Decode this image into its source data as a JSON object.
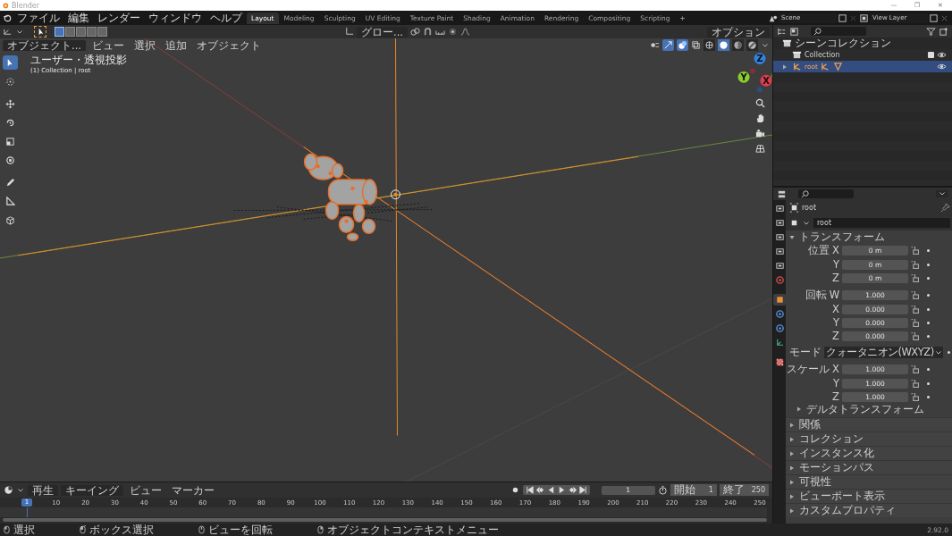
{
  "window": {
    "title": "Blender",
    "controls": [
      "—",
      "❐",
      "✕"
    ]
  },
  "menu": [
    "ファイル",
    "編集",
    "レンダー",
    "ウィンドウ",
    "ヘルプ"
  ],
  "workspace_tabs": [
    {
      "label": "Layout",
      "selected": true
    },
    {
      "label": "Modeling",
      "selected": false
    },
    {
      "label": "Sculpting",
      "selected": false
    },
    {
      "label": "UV Editing",
      "selected": false
    },
    {
      "label": "Texture Paint",
      "selected": false
    },
    {
      "label": "Shading",
      "selected": false
    },
    {
      "label": "Animation",
      "selected": false
    },
    {
      "label": "Rendering",
      "selected": false
    },
    {
      "label": "Compositing",
      "selected": false
    },
    {
      "label": "Scripting",
      "selected": false
    }
  ],
  "add_tab": "+",
  "scene": {
    "name": "Scene"
  },
  "view_layer": {
    "name": "View Layer"
  },
  "viewport": {
    "select_modes": [
      {
        "selected": true
      },
      {
        "selected": false
      },
      {
        "selected": false
      },
      {
        "selected": false
      },
      {
        "selected": false
      }
    ],
    "orientation": "グロー...",
    "mode": "オブジェクト...",
    "menus": [
      "ビュー",
      "選択",
      "追加",
      "オブジェクト"
    ],
    "options": "オプション",
    "shading": [
      {
        "kind": "wireframe",
        "selected": false
      },
      {
        "kind": "solid",
        "selected": true
      },
      {
        "kind": "material",
        "selected": false
      },
      {
        "kind": "rendered",
        "selected": false
      }
    ],
    "view_name": "ユーザー・透視投影",
    "context": "(1) Collection | root",
    "tools": [
      {
        "kind": "select",
        "selected": true
      },
      {
        "kind": "cursor",
        "selected": false
      },
      {
        "kind": "move",
        "selected": false
      },
      {
        "kind": "rotate",
        "selected": false
      },
      {
        "kind": "scale",
        "selected": false
      },
      {
        "kind": "transform",
        "selected": false
      },
      {
        "kind": "annotate",
        "selected": false
      },
      {
        "kind": "measure",
        "selected": false
      },
      {
        "kind": "add-cube",
        "selected": false
      }
    ],
    "gizmo": {
      "x": "X",
      "y": "Y",
      "z": "Z"
    }
  },
  "outliner": {
    "title": "シーンコレクション",
    "items": [
      {
        "kind": "collection",
        "name": "Collection",
        "selected": false,
        "checked": true
      },
      {
        "kind": "armature",
        "name": "root",
        "selected": true,
        "expanded": false
      }
    ]
  },
  "properties": {
    "tabs": [
      {
        "kind": "tool",
        "selected": false
      },
      {
        "kind": "render",
        "selected": false
      },
      {
        "kind": "output",
        "selected": false
      },
      {
        "kind": "view-layer",
        "selected": false
      },
      {
        "kind": "scene",
        "selected": false
      },
      {
        "kind": "world",
        "selected": false
      },
      {
        "kind": "object",
        "selected": true
      },
      {
        "kind": "physics",
        "selected": false
      },
      {
        "kind": "constraints",
        "selected": false
      },
      {
        "kind": "data",
        "selected": false
      },
      {
        "kind": "texture",
        "selected": false
      }
    ],
    "object_name": "root",
    "data_name": "root",
    "transform": {
      "title": "トランスフォーム",
      "expanded": true,
      "groups": [
        {
          "label": "位置",
          "rows": [
            {
              "axis": "X",
              "value": "0 m"
            },
            {
              "axis": "Y",
              "value": "0 m"
            },
            {
              "axis": "Z",
              "value": "0 m"
            }
          ]
        },
        {
          "label": "回転",
          "rows": [
            {
              "axis": "W",
              "value": "1.000"
            },
            {
              "axis": "X",
              "value": "0.000"
            },
            {
              "axis": "Y",
              "value": "0.000"
            },
            {
              "axis": "Z",
              "value": "0.000"
            }
          ]
        }
      ],
      "mode": {
        "label": "モード",
        "value": "クォータニオン(WXYZ)"
      },
      "scale": {
        "label": "スケール",
        "rows": [
          {
            "axis": "X",
            "value": "1.000"
          },
          {
            "axis": "Y",
            "value": "1.000"
          },
          {
            "axis": "Z",
            "value": "1.000"
          }
        ]
      },
      "delta": {
        "title": "デルタトランスフォーム",
        "expanded": false
      }
    },
    "sections": [
      {
        "title": "関係",
        "expanded": false
      },
      {
        "title": "コレクション",
        "expanded": false
      },
      {
        "title": "インスタンス化",
        "expanded": false
      },
      {
        "title": "モーションパス",
        "expanded": false
      },
      {
        "title": "可視性",
        "expanded": false
      },
      {
        "title": "ビューポート表示",
        "expanded": false
      },
      {
        "title": "カスタムプロパティ",
        "expanded": false
      }
    ]
  },
  "timeline": {
    "menus": [
      {
        "label": "再生",
        "dropdown": true
      },
      {
        "label": "キーイング",
        "dropdown": true
      },
      {
        "label": "ビュー",
        "dropdown": false
      },
      {
        "label": "マーカー",
        "dropdown": false
      }
    ],
    "current_frame": "1",
    "start_label": "開始",
    "start": "1",
    "end_label": "終了",
    "end": "250",
    "ruler": [
      "1",
      "10",
      "20",
      "30",
      "40",
      "50",
      "60",
      "70",
      "80",
      "90",
      "100",
      "110",
      "120",
      "130",
      "140",
      "150",
      "160",
      "170",
      "180",
      "190",
      "200",
      "210",
      "220",
      "230",
      "240",
      "250"
    ]
  },
  "status_bar": {
    "hints": [
      {
        "kind": "left-click",
        "label": "選択"
      },
      {
        "kind": "drag",
        "label": "ボックス選択"
      },
      {
        "kind": "middle-click",
        "label": "ビューを回転"
      },
      {
        "kind": "right-click",
        "label": "オブジェクトコンテキストメニュー"
      }
    ],
    "version": "2.92.0"
  }
}
